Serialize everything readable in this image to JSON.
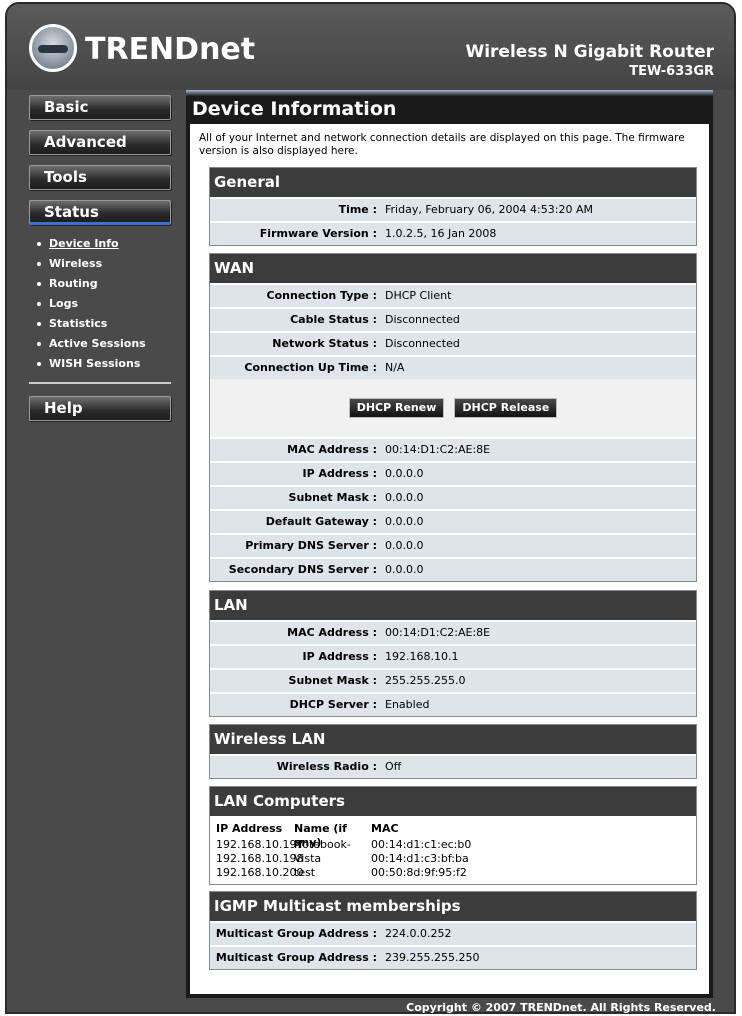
{
  "header": {
    "brand": "TRENDnet",
    "product_name": "Wireless N Gigabit Router",
    "model": "TEW-633GR"
  },
  "sidebar": {
    "items": [
      {
        "label": "Basic"
      },
      {
        "label": "Advanced"
      },
      {
        "label": "Tools"
      },
      {
        "label": "Status"
      },
      {
        "label": "Help"
      }
    ],
    "status_submenu": [
      {
        "label": "Device Info"
      },
      {
        "label": "Wireless"
      },
      {
        "label": "Routing"
      },
      {
        "label": "Logs"
      },
      {
        "label": "Statistics"
      },
      {
        "label": "Active Sessions"
      },
      {
        "label": "WISH Sessions"
      }
    ]
  },
  "page": {
    "title": "Device Information",
    "intro": "All of your Internet and network connection details are displayed on this page. The firmware version is also displayed here."
  },
  "general": {
    "title": "General",
    "rows": [
      {
        "label": "Time",
        "value": "Friday, February 06, 2004 4:53:20 AM"
      },
      {
        "label": "Firmware Version",
        "value": "1.0.2.5,  16 Jan 2008"
      }
    ]
  },
  "wan": {
    "title": "WAN",
    "rows_top": [
      {
        "label": "Connection Type",
        "value": "DHCP Client"
      },
      {
        "label": "Cable Status",
        "value": "Disconnected"
      },
      {
        "label": "Network Status",
        "value": "Disconnected"
      },
      {
        "label": "Connection Up Time",
        "value": "N/A"
      }
    ],
    "renew_label": "DHCP Renew",
    "release_label": "DHCP Release",
    "rows_bottom": [
      {
        "label": "MAC Address",
        "value": "00:14:D1:C2:AE:8E"
      },
      {
        "label": "IP Address",
        "value": "0.0.0.0"
      },
      {
        "label": "Subnet Mask",
        "value": "0.0.0.0"
      },
      {
        "label": "Default Gateway",
        "value": "0.0.0.0"
      },
      {
        "label": "Primary DNS Server",
        "value": "0.0.0.0"
      },
      {
        "label": "Secondary DNS Server",
        "value": "0.0.0.0"
      }
    ]
  },
  "lan": {
    "title": "LAN",
    "rows": [
      {
        "label": "MAC Address",
        "value": "00:14:D1:C2:AE:8E"
      },
      {
        "label": "IP Address",
        "value": "192.168.10.1"
      },
      {
        "label": "Subnet Mask",
        "value": "255.255.255.0"
      },
      {
        "label": "DHCP Server",
        "value": "Enabled"
      }
    ]
  },
  "wireless_lan": {
    "title": "Wireless LAN",
    "rows": [
      {
        "label": "Wireless Radio",
        "value": "Off"
      }
    ]
  },
  "lan_computers": {
    "title": "LAN Computers",
    "headers": [
      "IP Address",
      "Name (if any)",
      "MAC"
    ],
    "rows": [
      [
        "192.168.10.197",
        "Notebook-Vista",
        "00:14:d1:c1:ec:b0"
      ],
      [
        "192.168.10.198",
        "",
        "00:14:d1:c3:bf:ba"
      ],
      [
        "192.168.10.200",
        "test",
        "00:50:8d:9f:95:f2"
      ]
    ]
  },
  "igmp": {
    "title": "IGMP Multicast memberships",
    "rows": [
      {
        "label": "Multicast Group Address",
        "value": "224.0.0.252"
      },
      {
        "label": "Multicast Group Address",
        "value": "239.255.255.250"
      }
    ]
  },
  "footer": {
    "copyright": "Copyright © 2007 TRENDnet. All Rights Reserved."
  }
}
